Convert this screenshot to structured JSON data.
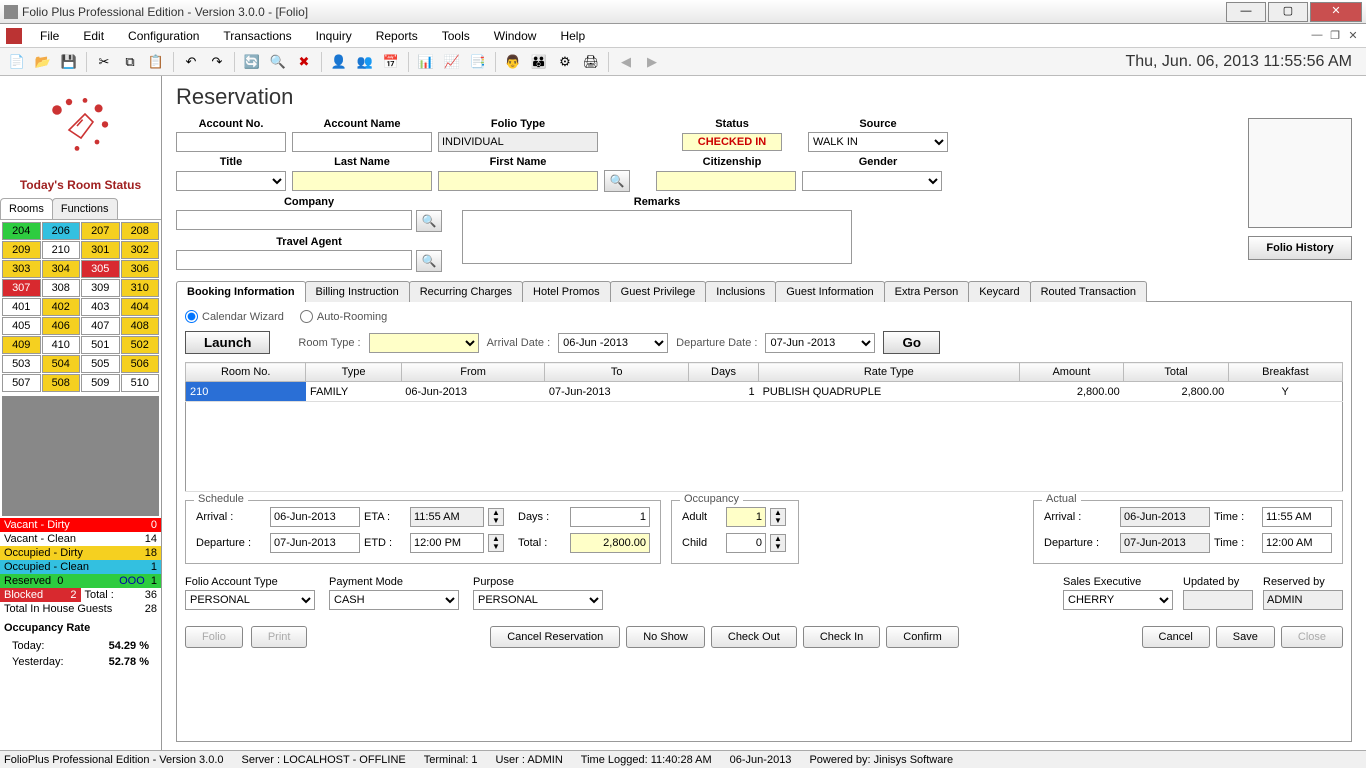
{
  "app": {
    "title": "Folio Plus Professional Edition - Version 3.0.0 - [Folio]",
    "datetime": "Thu, Jun. 06, 2013 11:55:56 AM"
  },
  "menus": [
    "File",
    "Edit",
    "Configuration",
    "Transactions",
    "Inquiry",
    "Reports",
    "Tools",
    "Window",
    "Help"
  ],
  "left": {
    "heading": "Today's Room Status",
    "tabs": {
      "rooms": "Rooms",
      "functions": "Functions"
    },
    "rooms": [
      {
        "n": "204",
        "c": "c-green"
      },
      {
        "n": "206",
        "c": "c-cyan"
      },
      {
        "n": "207",
        "c": "c-yellow"
      },
      {
        "n": "208",
        "c": "c-yellow"
      },
      {
        "n": "209",
        "c": "c-yellow"
      },
      {
        "n": "210",
        "c": "c-white"
      },
      {
        "n": "301",
        "c": "c-yellow"
      },
      {
        "n": "302",
        "c": "c-yellow"
      },
      {
        "n": "303",
        "c": "c-yellow"
      },
      {
        "n": "304",
        "c": "c-yellow"
      },
      {
        "n": "305",
        "c": "c-red"
      },
      {
        "n": "306",
        "c": "c-yellow"
      },
      {
        "n": "307",
        "c": "c-red"
      },
      {
        "n": "308",
        "c": "c-white"
      },
      {
        "n": "309",
        "c": "c-white"
      },
      {
        "n": "310",
        "c": "c-yellow"
      },
      {
        "n": "401",
        "c": "c-white"
      },
      {
        "n": "402",
        "c": "c-yellow"
      },
      {
        "n": "403",
        "c": "c-white"
      },
      {
        "n": "404",
        "c": "c-yellow"
      },
      {
        "n": "405",
        "c": "c-white"
      },
      {
        "n": "406",
        "c": "c-yellow"
      },
      {
        "n": "407",
        "c": "c-white"
      },
      {
        "n": "408",
        "c": "c-yellow"
      },
      {
        "n": "409",
        "c": "c-yellow"
      },
      {
        "n": "410",
        "c": "c-white"
      },
      {
        "n": "501",
        "c": "c-white"
      },
      {
        "n": "502",
        "c": "c-yellow"
      },
      {
        "n": "503",
        "c": "c-white"
      },
      {
        "n": "504",
        "c": "c-yellow"
      },
      {
        "n": "505",
        "c": "c-white"
      },
      {
        "n": "506",
        "c": "c-yellow"
      },
      {
        "n": "507",
        "c": "c-white"
      },
      {
        "n": "508",
        "c": "c-yellow"
      },
      {
        "n": "509",
        "c": "c-white"
      },
      {
        "n": "510",
        "c": "c-white"
      }
    ],
    "legend": {
      "vd": {
        "label": "Vacant - Dirty",
        "count": "0"
      },
      "vc": {
        "label": "Vacant - Clean",
        "count": "14"
      },
      "od": {
        "label": "Occupied - Dirty",
        "count": "18"
      },
      "oc": {
        "label": "Occupied - Clean",
        "count": "1"
      },
      "res": {
        "label": "Reserved",
        "count": "0",
        "ooo_label": "OOO",
        "ooo_count": "1"
      },
      "blk": {
        "label": "Blocked",
        "count": "2",
        "total_label": "Total :",
        "total": "36"
      },
      "inhouse": {
        "label": "Total In House Guests",
        "count": "28"
      }
    },
    "occupancy": {
      "title": "Occupancy Rate",
      "today_l": "Today:",
      "today_v": "54.29 %",
      "yest_l": "Yesterday:",
      "yest_v": "52.78 %"
    }
  },
  "page": {
    "title": "Reservation",
    "labels": {
      "account_no": "Account No.",
      "account_name": "Account Name",
      "folio_type": "Folio Type",
      "status": "Status",
      "source": "Source",
      "title_f": "Title",
      "last_name": "Last Name",
      "first_name": "First Name",
      "citizenship": "Citizenship",
      "gender": "Gender",
      "company": "Company",
      "remarks": "Remarks",
      "travel_agent": "Travel Agent",
      "folio_history": "Folio History"
    },
    "values": {
      "folio_type": "INDIVIDUAL",
      "status": "CHECKED IN",
      "source": "WALK IN"
    }
  },
  "tabs": [
    "Booking Information",
    "Billing Instruction",
    "Recurring Charges",
    "Hotel Promos",
    "Guest Privilege",
    "Inclusions",
    "Guest Information",
    "Extra Person",
    "Keycard",
    "Routed Transaction"
  ],
  "booking": {
    "calendar_wizard": "Calendar Wizard",
    "auto_rooming": "Auto-Rooming",
    "launch": "Launch",
    "room_type_l": "Room Type :",
    "arrival_l": "Arrival Date :",
    "departure_l": "Departure Date :",
    "go": "Go",
    "arrival_date": "06-Jun -2013",
    "departure_date": "07-Jun -2013",
    "cols": [
      "Room No.",
      "Type",
      "From",
      "To",
      "Days",
      "Rate Type",
      "Amount",
      "Total",
      "Breakfast"
    ],
    "row": {
      "room": "210",
      "type": "FAMILY",
      "from": "06-Jun-2013",
      "to": "07-Jun-2013",
      "days": "1",
      "rate": "PUBLISH QUADRUPLE",
      "amount": "2,800.00",
      "total": "2,800.00",
      "brk": "Y"
    }
  },
  "schedule": {
    "title": "Schedule",
    "arrival_l": "Arrival :",
    "arrival": "06-Jun-2013",
    "eta_l": "ETA :",
    "eta": "11:55 AM",
    "days_l": "Days :",
    "days": "1",
    "dep_l": "Departure :",
    "dep": "07-Jun-2013",
    "etd_l": "ETD :",
    "etd": "12:00 PM",
    "total_l": "Total :",
    "total": "2,800.00"
  },
  "occupancy_box": {
    "title": "Occupancy",
    "adult_l": "Adult",
    "adult": "1",
    "child_l": "Child",
    "child": "0"
  },
  "actual": {
    "title": "Actual",
    "arrival_l": "Arrival :",
    "arrival": "06-Jun-2013",
    "time1_l": "Time :",
    "time1": "11:55 AM",
    "dep_l": "Departure :",
    "dep": "07-Jun-2013",
    "time2_l": "Time :",
    "time2": "12:00 AM"
  },
  "bottom_sel": {
    "folio_acct_type_l": "Folio Account Type",
    "folio_acct_type": "PERSONAL",
    "payment_mode_l": "Payment Mode",
    "payment_mode": "CASH",
    "purpose_l": "Purpose",
    "purpose": "PERSONAL",
    "sales_exec_l": "Sales Executive",
    "sales_exec": "CHERRY",
    "updated_by_l": "Updated by",
    "updated_by": "",
    "reserved_by_l": "Reserved by",
    "reserved_by": "ADMIN"
  },
  "actions": {
    "folio": "Folio",
    "print": "Print",
    "cancel_res": "Cancel Reservation",
    "no_show": "No Show",
    "check_out": "Check Out",
    "check_in": "Check In",
    "confirm": "Confirm",
    "cancel": "Cancel",
    "save": "Save",
    "close": "Close"
  },
  "status": {
    "app": "FolioPlus Professional Edition - Version 3.0.0",
    "server": "Server : LOCALHOST - OFFLINE",
    "terminal": "Terminal: 1",
    "user": "User : ADMIN",
    "time_logged": "Time Logged: 11:40:28 AM",
    "date": "06-Jun-2013",
    "powered": "Powered by: Jinisys Software"
  }
}
